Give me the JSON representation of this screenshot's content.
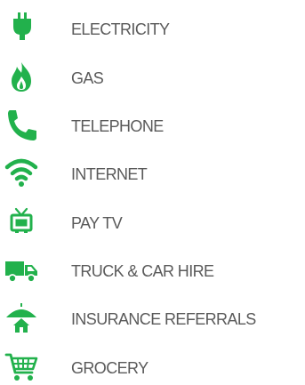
{
  "accent_color": "#22b14c",
  "services": [
    {
      "icon": "plug-icon",
      "label": "ELECTRICITY"
    },
    {
      "icon": "flame-icon",
      "label": "GAS"
    },
    {
      "icon": "telephone-icon",
      "label": "TELEPHONE"
    },
    {
      "icon": "wifi-icon",
      "label": "INTERNET"
    },
    {
      "icon": "tv-icon",
      "label": "PAY TV"
    },
    {
      "icon": "truck-icon",
      "label": "TRUCK & CAR HIRE"
    },
    {
      "icon": "umbrella-house-icon",
      "label": "INSURANCE REFERRALS"
    },
    {
      "icon": "shopping-cart-icon",
      "label": "GROCERY"
    }
  ]
}
